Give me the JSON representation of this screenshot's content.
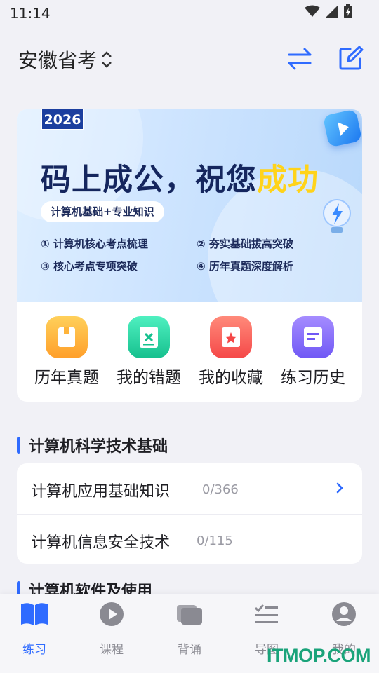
{
  "status_bar": {
    "time": "11:14"
  },
  "header": {
    "region": "安徽省考"
  },
  "banner": {
    "year": "2026",
    "title_main": "码上成公，祝您",
    "title_highlight": "成功",
    "pill": "计算机基础+专业知识",
    "points": [
      "① 计算机核心考点梳理",
      "② 夯实基础拔高突破",
      "③ 核心考点专项突破",
      "④ 历年真题深度解析"
    ]
  },
  "quick_actions": [
    {
      "label": "历年真题",
      "icon": "past-exams-icon",
      "color": "#ffb43a"
    },
    {
      "label": "我的错题",
      "icon": "wrong-questions-icon",
      "color": "#2ed3a4"
    },
    {
      "label": "我的收藏",
      "icon": "favorites-icon",
      "color": "#ff6a6a"
    },
    {
      "label": "练习历史",
      "icon": "practice-history-icon",
      "color": "#8a72ff"
    }
  ],
  "sections": [
    {
      "title": "计算机科学技术基础",
      "items": [
        {
          "name": "计算机应用基础知识",
          "count": "0/366"
        },
        {
          "name": "计算机信息安全技术",
          "count": "0/115"
        }
      ]
    },
    {
      "title": "计算机软件及使用"
    }
  ],
  "bottom_nav": [
    {
      "label": "练习",
      "icon": "book-icon",
      "active": true
    },
    {
      "label": "课程",
      "icon": "play-icon",
      "active": false
    },
    {
      "label": "背诵",
      "icon": "cards-icon",
      "active": false
    },
    {
      "label": "导图",
      "icon": "mindmap-icon",
      "active": false
    },
    {
      "label": "我的",
      "icon": "profile-icon",
      "active": false
    }
  ],
  "colors": {
    "accent": "#2f6bff",
    "background": "#f1f1f6",
    "watermark": "#1aa37a"
  },
  "watermark": "ITMOP.COM"
}
